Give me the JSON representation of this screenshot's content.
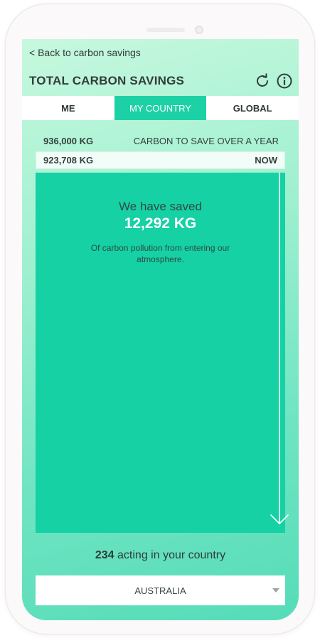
{
  "header": {
    "back_label": "< Back to carbon savings",
    "title": "TOTAL CARBON SAVINGS"
  },
  "tabs": [
    {
      "label": "ME",
      "active": false
    },
    {
      "label": "MY COUNTRY",
      "active": true
    },
    {
      "label": "GLOBAL",
      "active": false
    }
  ],
  "target": {
    "amount": "936,000 KG",
    "label": "CARBON TO SAVE OVER A YEAR"
  },
  "current": {
    "amount": "923,708 KG",
    "label": "NOW"
  },
  "saved": {
    "prefix": "We have saved",
    "value": "12,292 KG",
    "description": "Of carbon pollution from entering our atmosphere."
  },
  "acting": {
    "count": "234",
    "text": " acting in your country"
  },
  "country_select": {
    "selected": "AUSTRALIA"
  },
  "icons": {
    "refresh": "refresh-icon",
    "info": "info-icon",
    "arrow": "arrow-down-icon",
    "caret": "caret-down-icon"
  },
  "colors": {
    "accent": "#1dd1a6",
    "fill": "#15d1a4",
    "text_dark": "#333c3a"
  }
}
